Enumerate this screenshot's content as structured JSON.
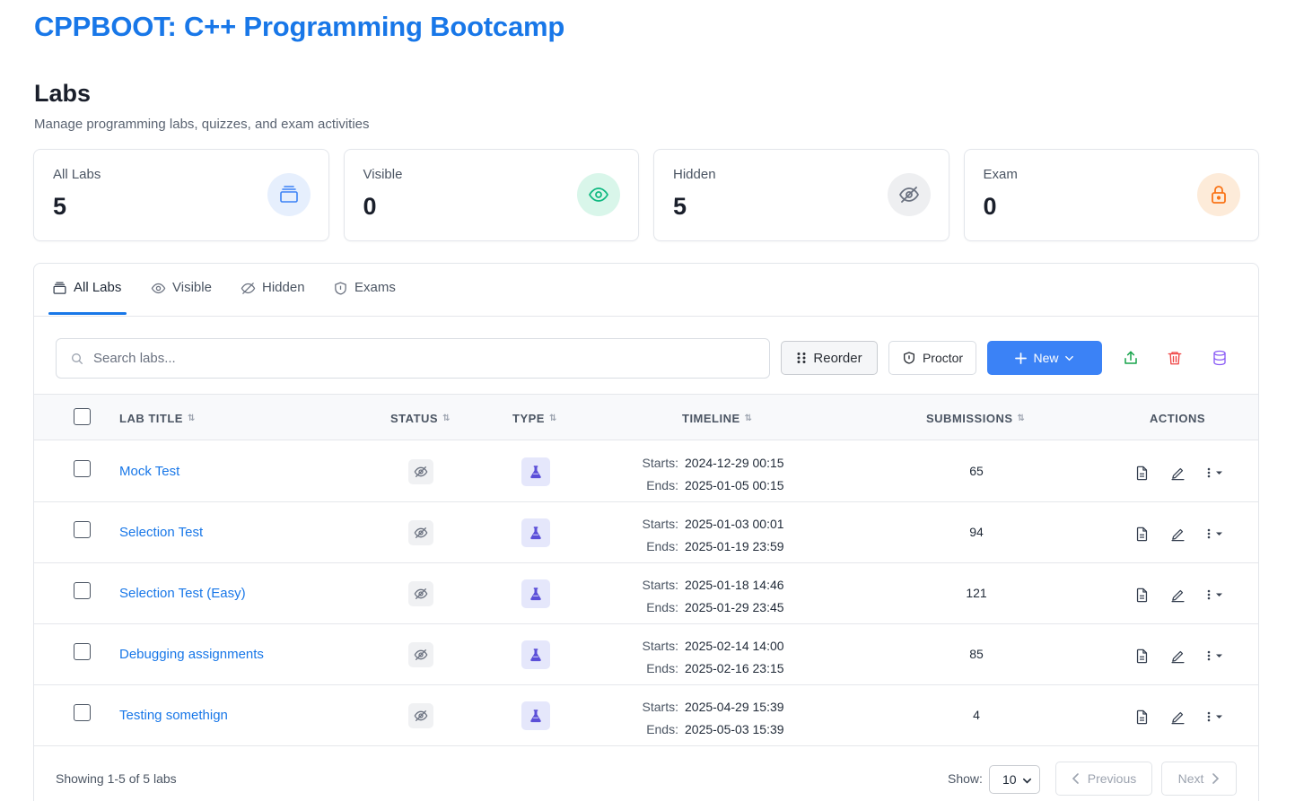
{
  "course": {
    "title": "CPPBOOT: C++ Programming Bootcamp"
  },
  "page": {
    "title": "Labs",
    "subtitle": "Manage programming labs, quizzes, and exam activities"
  },
  "stats": [
    {
      "label": "All Labs",
      "value": "5",
      "icon": "layers-icon",
      "icon_color": "#3b82f6",
      "bg": "#e6effd"
    },
    {
      "label": "Visible",
      "value": "0",
      "icon": "eye-icon",
      "icon_color": "#10b981",
      "bg": "#d9f6ea"
    },
    {
      "label": "Hidden",
      "value": "5",
      "icon": "eye-off-icon",
      "icon_color": "#6b7280",
      "bg": "#eeeff1"
    },
    {
      "label": "Exam",
      "value": "0",
      "icon": "lock-icon",
      "icon_color": "#f97316",
      "bg": "#fdebd9"
    }
  ],
  "tabs": [
    {
      "label": "All Labs",
      "active": true
    },
    {
      "label": "Visible",
      "active": false
    },
    {
      "label": "Hidden",
      "active": false
    },
    {
      "label": "Exams",
      "active": false
    }
  ],
  "toolbar": {
    "search_placeholder": "Search labs...",
    "reorder_label": "Reorder",
    "proctor_label": "Proctor",
    "new_label": "New"
  },
  "table": {
    "columns": [
      "LAB TITLE",
      "STATUS",
      "TYPE",
      "TIMELINE",
      "SUBMISSIONS",
      "ACTIONS"
    ],
    "starts_label": "Starts:",
    "ends_label": "Ends:",
    "rows": [
      {
        "title": "Mock Test",
        "status": "hidden",
        "type": "lab",
        "starts": "2024-12-29 00:15",
        "ends": "2025-01-05 00:15",
        "submissions": "65"
      },
      {
        "title": "Selection Test",
        "status": "hidden",
        "type": "lab",
        "starts": "2025-01-03 00:01",
        "ends": "2025-01-19 23:59",
        "submissions": "94"
      },
      {
        "title": "Selection Test (Easy)",
        "status": "hidden",
        "type": "lab",
        "starts": "2025-01-18 14:46",
        "ends": "2025-01-29 23:45",
        "submissions": "121"
      },
      {
        "title": "Debugging assignments",
        "status": "hidden",
        "type": "lab",
        "starts": "2025-02-14 14:00",
        "ends": "2025-02-16 23:15",
        "submissions": "85"
      },
      {
        "title": "Testing somethign",
        "status": "hidden",
        "type": "lab",
        "starts": "2025-04-29 15:39",
        "ends": "2025-05-03 15:39",
        "submissions": "4"
      }
    ]
  },
  "footer": {
    "showing": "Showing 1-5 of 5 labs",
    "show_label": "Show:",
    "page_size": "10",
    "previous_label": "Previous",
    "next_label": "Next"
  },
  "colors": {
    "brand": "#1877e8",
    "primary_button": "#3b82f6",
    "type_icon": "#5b4fd8"
  }
}
